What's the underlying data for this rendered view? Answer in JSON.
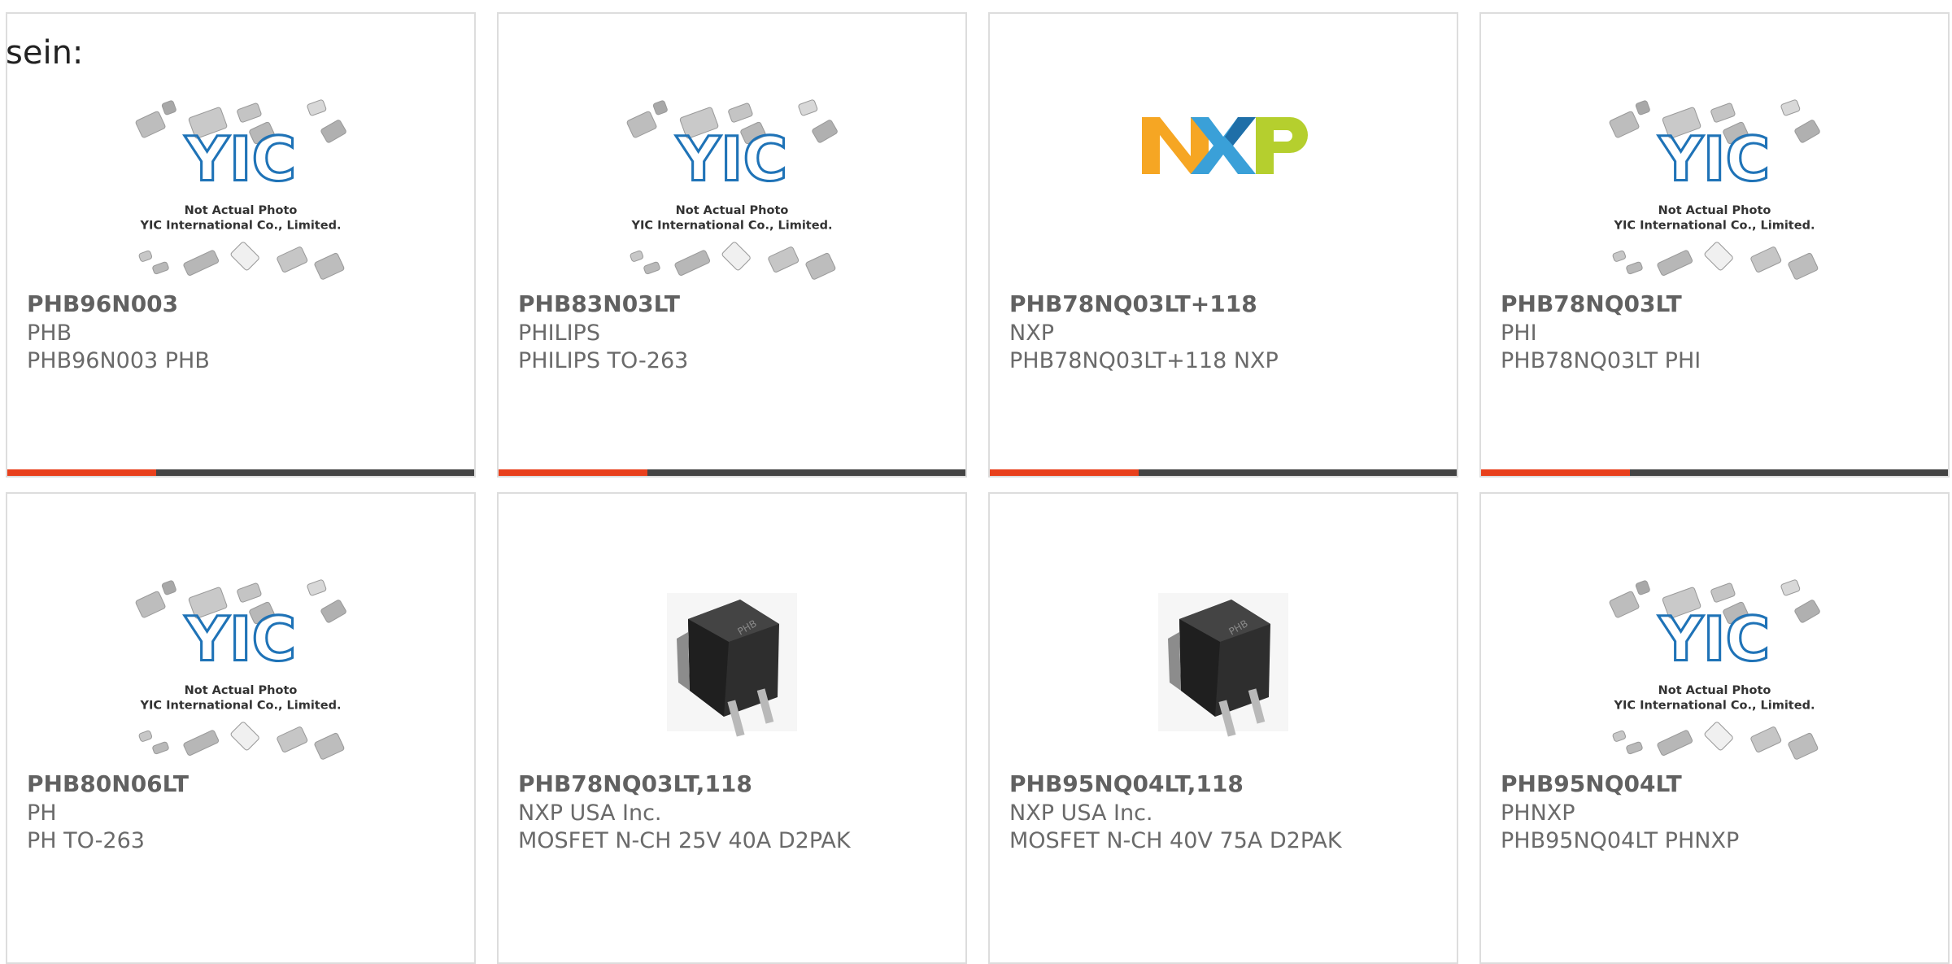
{
  "intro_text": "sein:",
  "placeholder_lines": [
    "Not Actual Photo",
    "YIC International Co., Limited."
  ],
  "colors": {
    "accent": "#e8401c",
    "bar_dark": "#444444",
    "yic_blue": "#1f73b7"
  },
  "products": [
    {
      "part": "PHB96N003",
      "maker": "PHB",
      "desc": "PHB96N003 PHB",
      "image": "yic-placeholder"
    },
    {
      "part": "PHB83N03LT",
      "maker": "PHILIPS",
      "desc": "PHILIPS TO-263",
      "image": "yic-placeholder"
    },
    {
      "part": "PHB78NQ03LT+118",
      "maker": "NXP",
      "desc": "PHB78NQ03LT+118 NXP",
      "image": "nxp-logo"
    },
    {
      "part": "PHB78NQ03LT",
      "maker": "PHI",
      "desc": "PHB78NQ03LT PHI",
      "image": "yic-placeholder"
    },
    {
      "part": "PHB80N06LT",
      "maker": "PH",
      "desc": "PH TO-263",
      "image": "yic-placeholder"
    },
    {
      "part": "PHB78NQ03LT,118",
      "maker": "NXP USA Inc.",
      "desc": "MOSFET N-CH 25V 40A D2PAK",
      "image": "d2pak-package"
    },
    {
      "part": "PHB95NQ04LT,118",
      "maker": "NXP USA Inc.",
      "desc": "MOSFET N-CH 40V 75A D2PAK",
      "image": "d2pak-package"
    },
    {
      "part": "PHB95NQ04LT",
      "maker": "PHNXP",
      "desc": "PHB95NQ04LT PHNXP",
      "image": "yic-placeholder"
    }
  ]
}
